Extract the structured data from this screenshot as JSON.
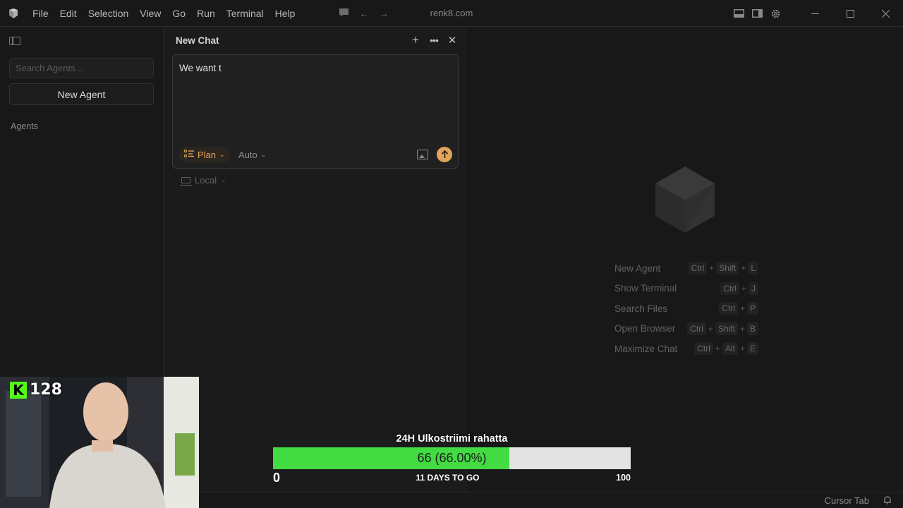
{
  "titlebar": {
    "menu": [
      "File",
      "Edit",
      "Selection",
      "View",
      "Go",
      "Run",
      "Terminal",
      "Help"
    ],
    "window_title": "renk8.com"
  },
  "sidebar": {
    "search_placeholder": "Search Agents...",
    "new_agent_label": "New Agent",
    "agents_heading": "Agents"
  },
  "chat": {
    "title": "New Chat",
    "input_text": "We want t",
    "mode_label": "Plan",
    "model_label": "Auto",
    "environment_label": "Local",
    "accent_color": "#e2a45c"
  },
  "welcome": {
    "shortcuts": [
      {
        "label": "New Agent",
        "keys": [
          "Ctrl",
          "Shift",
          "L"
        ]
      },
      {
        "label": "Show Terminal",
        "keys": [
          "Ctrl",
          "J"
        ]
      },
      {
        "label": "Search Files",
        "keys": [
          "Ctrl",
          "P"
        ]
      },
      {
        "label": "Open Browser",
        "keys": [
          "Ctrl",
          "Shift",
          "B"
        ]
      },
      {
        "label": "Maximize Chat",
        "keys": [
          "Ctrl",
          "Alt",
          "E"
        ]
      }
    ]
  },
  "statusbar": {
    "cursor_tab_label": "Cursor Tab"
  },
  "stream_overlay": {
    "kick_viewers": "128",
    "kick_color": "#53fc18",
    "goal": {
      "title": "24H Ulkostriimi rahatta",
      "value_text": "66 (66.00%)",
      "progress": 0.66,
      "min_label": "0",
      "max_label": "100",
      "days_text": "11 DAYS TO GO",
      "fill_color": "#42db42"
    }
  }
}
